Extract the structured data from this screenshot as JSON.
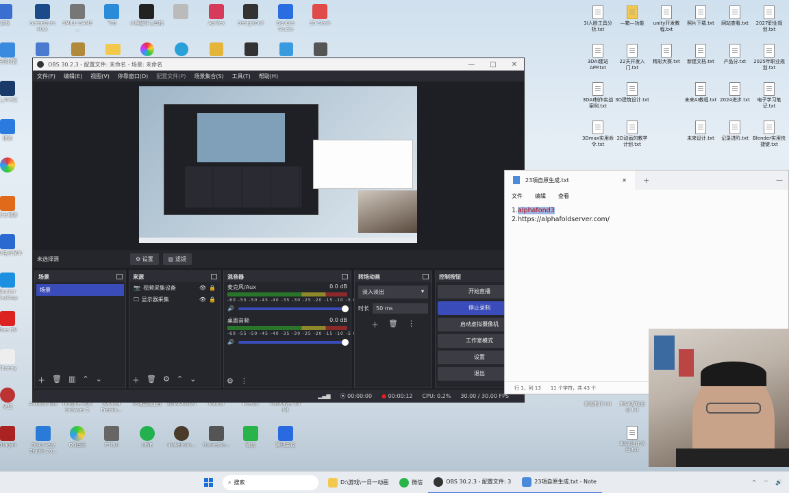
{
  "desktop": {
    "top_row": [
      "游戏",
      "GameGuru MAX",
      "SMILE GAME ...",
      "飞书",
      "小熊蓝牙工具箱",
      "",
      "Aprilex",
      "DesignDoll",
      "DevEco Studio",
      "3D Slash"
    ],
    "left_column": [
      "全部设置",
      "向日葵",
      "",
      "N_AV3文",
      "猎豹",
      "",
      "影云电脑",
      "大众电子保单",
      "Docker Desktop",
      "Trae CN",
      "Thonny",
      "火狐",
      "Dragon"
    ],
    "bottom_row": [
      "Arduino IDE",
      "Unigine SDK browser 2",
      "Navicat Premiu...",
      "环境监测工具",
      "3DMAX2024",
      "Maxon",
      "Firefox",
      "PotPlayer 64 bit"
    ],
    "bottom_row2": [
      "Discovery Studio 20...",
      "QQ音乐",
      "PTGui",
      "LINE",
      "makehum...",
      "GameCre...",
      "微信",
      "腾讯会议"
    ],
    "right_files": [
      "3I人脸工具分析.txt",
      "—箱—功能",
      "unity开发教程.txt",
      "照片下载.txt",
      "网站查看.txt",
      "2027职业规划.txt",
      "3DAI建站APP.txt",
      "22天开发入门.txt",
      "精彩大赛.txt",
      "新建文档.txt",
      "产品分.txt",
      "2025年职业规划.txt",
      "3DAI制作实战案例.txt",
      "3D建筑设计.txt",
      "未来AI教程.txt",
      "2024进步.txt",
      "电子学习笔记.txt",
      "3Dmax实用命令.txt",
      "2D动画的教学计划.txt",
      "未来设计.txt",
      "记录进阶.txt",
      "Blender实用快捷键.txt",
      "影视制作.txt",
      "3DAI游戏设计.txt",
      "新建游戏计划.txt",
      "3DAI设计文档.txt"
    ]
  },
  "obs": {
    "title": "OBS 30.2.3 - 配置文件: 未命名 - 场景: 未命名",
    "menu": [
      "文件(F)",
      "编辑(E)",
      "视图(V)",
      "停靠窗口(D)",
      "配置文件(P)",
      "场景集合(S)",
      "工具(T)",
      "帮助(H)"
    ],
    "no_source": "未选择源",
    "settings_btn": "设置",
    "filters_btn": "滤镜",
    "scenes": {
      "title": "场景",
      "items": [
        "场景"
      ]
    },
    "sources": {
      "title": "来源",
      "items": [
        "视频采集设备",
        "显示器采集"
      ]
    },
    "mixer": {
      "title": "混音器",
      "channels": [
        {
          "name": "麦克风/Aux",
          "db": "0.0 dB"
        },
        {
          "name": "桌面音频",
          "db": "0.0 dB"
        }
      ],
      "ticks": "-60 -55 -50 -45 -40 -35 -30 -25 -20 -15 -10 -5 0"
    },
    "transitions": {
      "title": "转场动画",
      "selected": "淡入淡出",
      "duration_label": "时长",
      "duration": "50 ms"
    },
    "controls": {
      "title": "控制按钮",
      "buttons": [
        "开始直播",
        "停止录制",
        "启动虚拟摄像机",
        "工作室模式",
        "设置",
        "退出"
      ]
    },
    "status": {
      "stream_time": "00:00:00",
      "rec_time": "00:00:12",
      "cpu": "CPU: 0.2%",
      "fps": "30.00 / 30.00 FPS"
    }
  },
  "notepad": {
    "tab_title": "23項自原生成.txt",
    "menu": [
      "文件",
      "编辑",
      "查看"
    ],
    "line1_prefix": "1.",
    "line1_selected": "alphafond3",
    "line2": "2.https://alphafoldserver.com/",
    "status_pos": "行 1，列 13",
    "status_chars": "11 个字符，共 43 个"
  },
  "taskbar": {
    "search_placeholder": "搜索",
    "items": [
      "D:\\游戏\\一日一动画",
      "微信",
      "OBS 30.2.3 - 配置文件: 3",
      "23項自原生成.txt - Note"
    ]
  },
  "colors": {
    "obs_bg": "#1e1f24",
    "accent": "#3a4cba",
    "rec_red": "#e02020"
  }
}
